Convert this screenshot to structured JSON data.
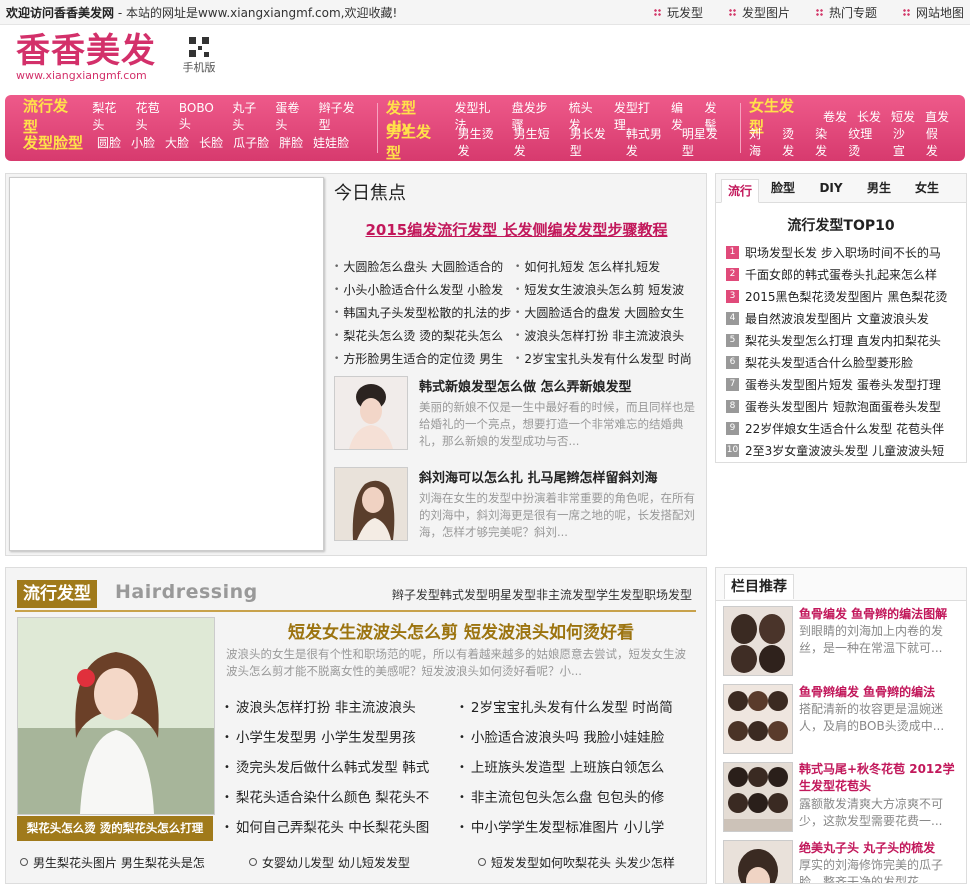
{
  "topbar": {
    "welcome": "欢迎访问香香美发网",
    "domain_note": " - 本站的网址是www.xiangxiangmf.com,欢迎收藏!",
    "links": [
      "玩发型",
      "发型图片",
      "热门专题",
      "网站地图"
    ]
  },
  "header": {
    "logo_text": "香香美发",
    "logo_url": "www.xiangxiangmf.com",
    "mobile_label": "手机版"
  },
  "nav": {
    "group1": {
      "row1_head": "流行发型",
      "row1_items": [
        "梨花头",
        "花苞头",
        "BOBO头",
        "丸子头",
        "蛋卷头",
        "辫子发型"
      ],
      "row2_head": "发型脸型",
      "row2_items": [
        "圆脸",
        "小脸",
        "大脸",
        "长脸",
        "瓜子脸",
        "胖脸",
        "娃娃脸"
      ]
    },
    "group2": {
      "row1_head": "发型diy",
      "row1_items": [
        "发型扎法",
        "盘发步骤",
        "梳头发",
        "发型打理",
        "编发",
        "发髻"
      ],
      "row2_head": "男生发型",
      "row2_items": [
        "男生烫发",
        "男生短发",
        "男长发型",
        "韩式男发",
        "明星发型"
      ]
    },
    "group3": {
      "row1_head": "女生发型",
      "row1_items": [
        "卷发",
        "长发",
        "短发",
        "直发"
      ],
      "row2_items": [
        "刘海",
        "烫发",
        "染发",
        "纹理烫",
        "沙宣",
        "假发"
      ]
    }
  },
  "focus": {
    "title": "今日焦点",
    "headline": "2015编发流行发型 长发侧编发发型步骤教程",
    "list": [
      "大圆脸怎么盘头 大圆脸适合的",
      "如何扎短发 怎么样扎短发",
      "小头小脸适合什么发型 小脸发",
      "短发女生波浪头怎么剪 短发波",
      "韩国丸子头发型松散的扎法的步",
      "大圆脸适合的盘发 大圆脸女生",
      "梨花头怎么烫 烫的梨花头怎么",
      "波浪头怎样打扮 非主流波浪头",
      "方形脸男生适合的定位烫 男生",
      "2岁宝宝扎头发有什么发型 时尚"
    ],
    "news": [
      {
        "title": "韩式新娘发型怎么做 怎么弄新娘发型",
        "desc": "美丽的新娘不仅是一生中最好看的时候，而且同样也是给婚礼的一个亮点，想要打造一个非常难忘的结婚典礼，那么新娘的发型成功与否..."
      },
      {
        "title": "斜刘海可以怎么扎 扎马尾辫怎样留斜刘海",
        "desc": "刘海在女生的发型中扮演着非常重要的角色呢，在所有的刘海中，斜刘海更是很有一席之地的呢，长发搭配刘海，怎样才够完美呢？斜刘..."
      }
    ]
  },
  "top10": {
    "tabs": [
      "流行",
      "脸型",
      "DIY",
      "男生",
      "女生"
    ],
    "title": "流行发型TOP10",
    "items": [
      "职场发型长发 步入职场时间不长的马",
      "千面女郎的韩式蛋卷头扎起来怎么样",
      "2015黑色梨花烫发型图片 黑色梨花烫",
      "最自然波浪发型图片 文童波浪头发",
      "梨花头发型怎么打理 直发内扣梨花头",
      "梨花头发型适合什么脸型菱形脸",
      "蛋卷头发型图片短发 蛋卷头发型打理",
      "蛋卷头发型图片 短款泡面蛋卷头发型",
      "22岁伴娘女生适合什么发型 花苞头伴",
      "2至3岁女童波波头发型 儿童波波头短"
    ],
    "nums": [
      "1",
      "2",
      "3",
      "4",
      "5",
      "6",
      "7",
      "8",
      "9",
      "10"
    ],
    "num_colors": [
      "#e04a7a",
      "#e04a7a",
      "#e04a7a",
      "#999999"
    ]
  },
  "trend": {
    "label": "流行发型",
    "english": "Hairdressing",
    "tabs": [
      "辫子发型",
      "韩式发型",
      "明星发型",
      "非主流发型",
      "学生发型",
      "职场发型"
    ],
    "caption": "梨花头怎么烫 烫的梨花头怎么打理",
    "headline": "短发女生波波头怎么剪 短发波浪头如何烫好看",
    "desc": "波浪头的女生是很有个性和职场范的呢，所以有着越来越多的姑娘愿意去尝试，短发女生波波头怎么剪才能不脱离女性的美感呢？短发波浪头如何烫好看呢？小...",
    "list": [
      "波浪头怎样打扮 非主流波浪头",
      "2岁宝宝扎头发有什么发型 时尚简",
      "小学生发型男 小学生发型男孩",
      "小脸适合波浪头吗 我脸小娃娃脸",
      "烫完头发后做什么韩式发型 韩式",
      "上班族头发造型 上班族白领怎么",
      "梨花头适合染什么颜色 梨花头不",
      "非主流包包头怎么盘 包包头的修",
      "如何自己弄梨花头 中长梨花头图",
      "中小学学生发型标准图片 小儿学"
    ],
    "bottom": [
      "男生梨花头图片 男生梨花头是怎",
      "女婴幼儿发型 幼儿短发发型",
      "短发发型如何吹梨花头 头发少怎样"
    ]
  },
  "recommend": {
    "title": "栏目推荐",
    "items": [
      {
        "title": "鱼骨编发 鱼骨辫的编法图解",
        "desc": "到眼睛的刘海加上内卷的发丝，是一种在常温下就可..."
      },
      {
        "title": "鱼骨辫编发 鱼骨辫的编法",
        "desc": "搭配清新的妆容更是温婉迷人，及肩的BOB头烫成中..."
      },
      {
        "title": "韩式马尾+秋冬花苞 2012学生发型花苞头",
        "desc": "露额散发清爽大方凉爽不可少，这款发型需要花费一..."
      },
      {
        "title": "绝美丸子头 丸子头的梳发",
        "desc": "厚实的刘海修饰完美的瓜子脸，整齐干净的发型花..."
      }
    ]
  }
}
